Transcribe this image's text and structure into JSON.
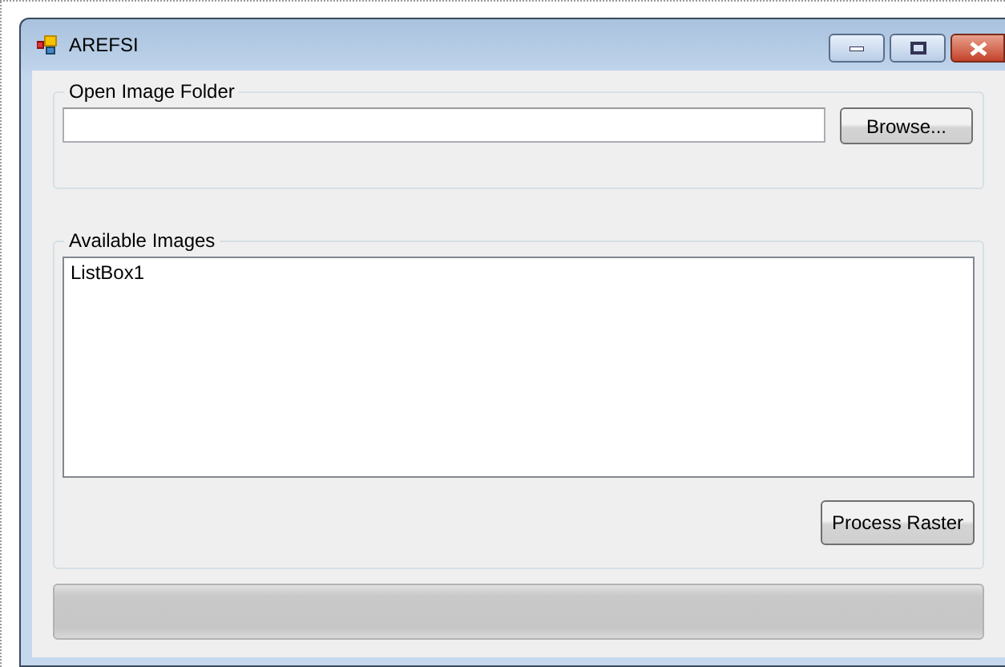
{
  "window": {
    "title": "AREFSI"
  },
  "open_folder_group": {
    "title": "Open Image Folder",
    "browse_button": "Browse..."
  },
  "images_group": {
    "title": "Available Images",
    "listbox": {
      "items": [
        "ListBox1"
      ]
    },
    "process_button": "Process Raster"
  },
  "progress": {
    "level": 0
  }
}
